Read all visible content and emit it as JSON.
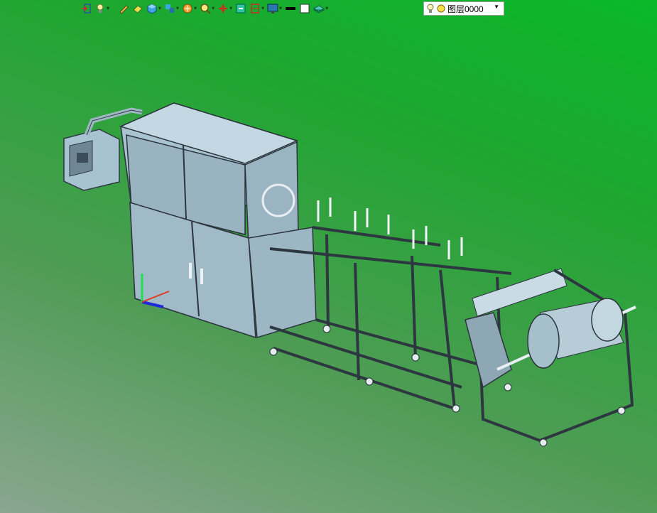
{
  "toolbar": {
    "buttons": [
      {
        "icon": "exit-icon",
        "has_menu": false
      },
      {
        "icon": "lightbulb-icon",
        "has_menu": true
      },
      {
        "icon": "pen-icon",
        "has_menu": false
      },
      {
        "icon": "eraser-icon",
        "has_menu": false
      },
      {
        "icon": "cube-icon",
        "has_menu": true
      },
      {
        "icon": "multi-view-icon",
        "has_menu": true
      },
      {
        "icon": "render-style-icon",
        "has_menu": true
      },
      {
        "icon": "zoom-icon",
        "has_menu": true
      },
      {
        "icon": "axis-icon",
        "has_menu": true
      },
      {
        "icon": "fit-icon",
        "has_menu": false
      },
      {
        "icon": "section-icon",
        "has_menu": true
      },
      {
        "icon": "display-icon",
        "has_menu": true
      },
      {
        "icon": "line-color-icon",
        "has_menu": false
      },
      {
        "icon": "fill-color-icon",
        "has_menu": false
      },
      {
        "icon": "layer-stack-icon",
        "has_menu": true
      }
    ]
  },
  "layer": {
    "current": "图层0000"
  },
  "colors": {
    "background_top": "#0ab82a",
    "background_bottom": "#8aa690",
    "machine_panel": "#9fbccc",
    "machine_frame": "#3c4650"
  }
}
